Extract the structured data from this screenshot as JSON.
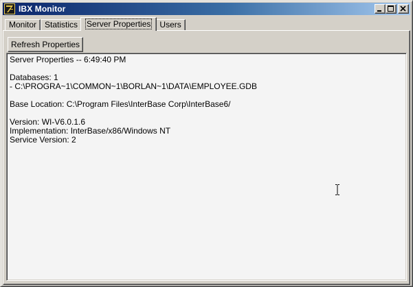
{
  "window": {
    "title": "IBX Monitor"
  },
  "tabs": [
    {
      "label": "Monitor",
      "active": false
    },
    {
      "label": "Statistics",
      "active": false
    },
    {
      "label": "Server Properties",
      "active": true
    },
    {
      "label": "Users",
      "active": false
    }
  ],
  "toolbar": {
    "refresh_label": "Refresh Properties"
  },
  "memo": {
    "lines": [
      "Server Properties -- 6:49:40 PM",
      "",
      "Databases: 1",
      "- C:\\PROGRA~1\\COMMON~1\\BORLAN~1\\DATA\\EMPLOYEE.GDB",
      "",
      "Base Location: C:\\Program Files\\InterBase Corp\\InterBase6/",
      "",
      "Version: WI-V6.0.1.6",
      "Implementation: InterBase/x86/Windows NT",
      "Service Version: 2"
    ]
  },
  "colors": {
    "titlebar_start": "#0a246a",
    "titlebar_end": "#a6caf0",
    "face": "#d4d0c8",
    "memo_bg": "#f4f4f4"
  },
  "icons": [
    "app-icon",
    "minimize-icon",
    "maximize-icon",
    "close-icon",
    "text-cursor-icon"
  ]
}
